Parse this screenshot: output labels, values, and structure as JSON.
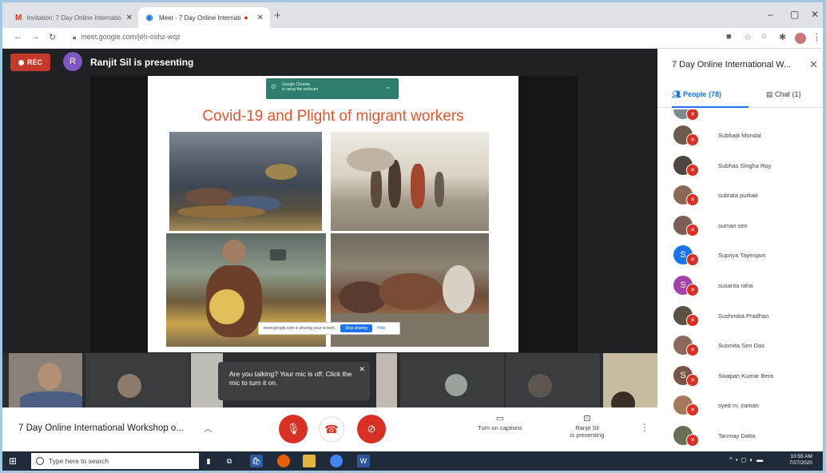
{
  "browser": {
    "tabs": [
      {
        "label": "Invitation: 7 Day Online Internatio",
        "icon": "gmail-icon"
      },
      {
        "label": "Meet - 7 Day Online Internati",
        "icon": "meet-icon"
      }
    ],
    "url": "meet.google.com/jeh-oshz-wqz"
  },
  "meet": {
    "rec_label": "REC",
    "presenter_initial": "R",
    "presenter_text": "Ranjit Sil is presenting",
    "share_banner_line1": "Google Chrome",
    "share_banner_line2": "is using the webcam",
    "slide_title": "Covid-19 and Plight of migrant workers",
    "sharing_text": "meet.google.com is sharing your screen.",
    "stop_sharing": "Stop sharing",
    "hide": "Hide",
    "tooltip": "Are you talking? Your mic is off. Click the mic to turn it on.",
    "meeting_title": "7 Day Online International Workshop o...",
    "captions_label": "Turn on captions",
    "presenting_label_1": "Ranjit Sil",
    "presenting_label_2": "is presenting"
  },
  "panel": {
    "title": "7 Day Online International W...",
    "people_tab": "People (78)",
    "chat_tab": "Chat (1)",
    "participants": [
      {
        "name": "Subhajit Mondal",
        "initial": "",
        "color": "#6d5a4a"
      },
      {
        "name": "Subhas Singha Roy",
        "initial": "",
        "color": "#4f4640"
      },
      {
        "name": "subrata purkait",
        "initial": "",
        "color": "#8a6a52"
      },
      {
        "name": "suman sen",
        "initial": "",
        "color": "#7b5d55"
      },
      {
        "name": "Supriya Tayenjam",
        "initial": "S",
        "color": "#1a73e8"
      },
      {
        "name": "susanta raha",
        "initial": "S",
        "color": "#a142a4"
      },
      {
        "name": "Sushmika Pradhan",
        "initial": "",
        "color": "#5c5145"
      },
      {
        "name": "Susmita Sen Das",
        "initial": "",
        "color": "#8b6a5d"
      },
      {
        "name": "Swapan Kumar Bera",
        "initial": "S",
        "color": "#795548"
      },
      {
        "name": "syed m. zaman",
        "initial": "",
        "color": "#a47a5e"
      },
      {
        "name": "Tanmay Datta",
        "initial": "",
        "color": "#6a6e55"
      }
    ]
  },
  "taskbar": {
    "search_placeholder": "Type here to search",
    "time": "10:55 AM",
    "date": "7/27/2020"
  }
}
